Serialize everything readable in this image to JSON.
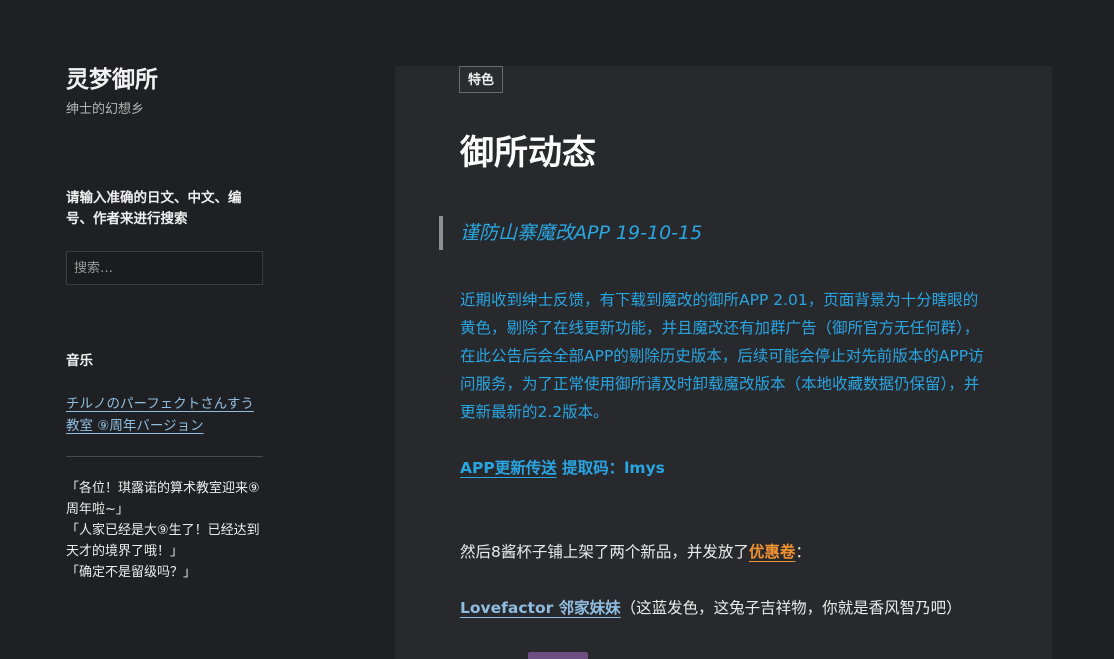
{
  "site": {
    "title": "灵梦御所",
    "description": "绅士的幻想乡"
  },
  "sidebar": {
    "search_widget_title": "请输入准确的日文、中文、编号、作者来进行搜索",
    "search_placeholder": "搜索…",
    "music_title": "音乐",
    "music_link": "チルノのパーフェクトさんすう教室 ⑨周年バージョン",
    "quotes": [
      "「各位！琪露诺的算术教室迎来⑨周年啦~」",
      "「人家已经是大⑨生了！已经达到天才的境界了哦！」",
      "「确定不是留级吗？」"
    ]
  },
  "article": {
    "tag": "特色",
    "title": "御所动态",
    "notice_heading": "谨防山寨魔改APP 19-10-15",
    "notice_body": "近期收到绅士反馈，有下载到魔改的御所APP 2.01，页面背景为十分瞎眼的黄色，剔除了在线更新功能，并且魔改还有加群广告（御所官方无任何群），在此公告后会全部APP的剔除历史版本，后续可能会停止对先前版本的APP访问服务，为了正常使用御所请及时卸载魔改版本（本地收藏数据仍保留），并更新最新的2.2版本。",
    "update_link": "APP更新传送",
    "update_code": " 提取码：lmys",
    "shop_text": "然后8酱杯子铺上架了两个新品，并发放了",
    "coupon_link": "优惠卷",
    "shop_suffix": "：",
    "product_link": "Lovefactor 邻家妹妹",
    "product_desc": "（这蓝发色，这兔子吉祥物，你就是香风智乃吧）"
  },
  "colors": {
    "background": "#1f2023",
    "panel": "#28292c",
    "accent_blue": "#29a5e2",
    "link_blue": "#8fbde0",
    "coupon_orange": "#f0922f"
  }
}
